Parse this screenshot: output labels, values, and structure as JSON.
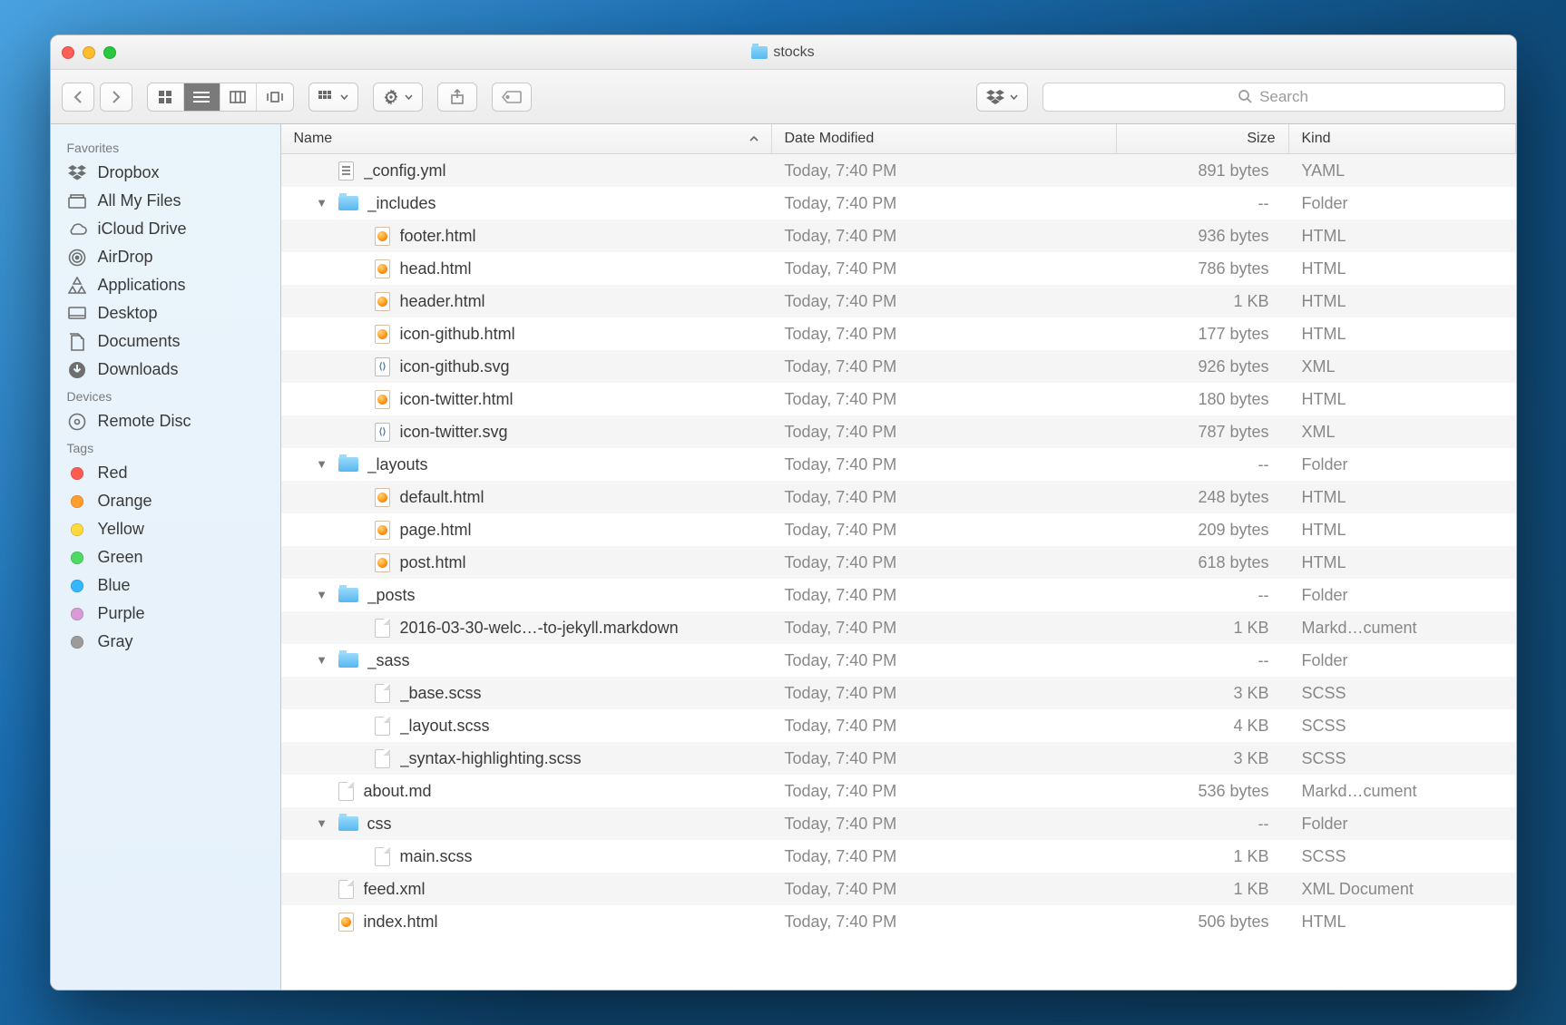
{
  "window": {
    "title": "stocks"
  },
  "toolbar": {
    "search_placeholder": "Search"
  },
  "sidebar": {
    "sections": [
      {
        "heading": "Favorites",
        "items": [
          {
            "icon": "dropbox-icon",
            "label": "Dropbox"
          },
          {
            "icon": "all-files-icon",
            "label": "All My Files"
          },
          {
            "icon": "cloud-icon",
            "label": "iCloud Drive"
          },
          {
            "icon": "airdrop-icon",
            "label": "AirDrop"
          },
          {
            "icon": "apps-icon",
            "label": "Applications"
          },
          {
            "icon": "desktop-icon",
            "label": "Desktop"
          },
          {
            "icon": "documents-icon",
            "label": "Documents"
          },
          {
            "icon": "downloads-icon",
            "label": "Downloads"
          }
        ]
      },
      {
        "heading": "Devices",
        "items": [
          {
            "icon": "disc-icon",
            "label": "Remote Disc"
          }
        ]
      },
      {
        "heading": "Tags",
        "items": [
          {
            "icon": "tag-dot",
            "color": "#ff5b52",
            "label": "Red"
          },
          {
            "icon": "tag-dot",
            "color": "#ff9e2d",
            "label": "Orange"
          },
          {
            "icon": "tag-dot",
            "color": "#ffd93b",
            "label": "Yellow"
          },
          {
            "icon": "tag-dot",
            "color": "#4cd964",
            "label": "Green"
          },
          {
            "icon": "tag-dot",
            "color": "#35b7ff",
            "label": "Blue"
          },
          {
            "icon": "tag-dot",
            "color": "#d99bd8",
            "label": "Purple"
          },
          {
            "icon": "tag-dot",
            "color": "#9b9b9b",
            "label": "Gray"
          }
        ]
      }
    ]
  },
  "columns": {
    "name": "Name",
    "date": "Date Modified",
    "size": "Size",
    "kind": "Kind"
  },
  "rows": [
    {
      "depth": 0,
      "disclosure": "",
      "type": "yaml",
      "name": "_config.yml",
      "date": "Today, 7:40 PM",
      "size": "891 bytes",
      "kind": "YAML"
    },
    {
      "depth": 0,
      "disclosure": "▼",
      "type": "folder",
      "name": "_includes",
      "date": "Today, 7:40 PM",
      "size": "--",
      "kind": "Folder"
    },
    {
      "depth": 1,
      "disclosure": "",
      "type": "html",
      "name": "footer.html",
      "date": "Today, 7:40 PM",
      "size": "936 bytes",
      "kind": "HTML"
    },
    {
      "depth": 1,
      "disclosure": "",
      "type": "html",
      "name": "head.html",
      "date": "Today, 7:40 PM",
      "size": "786 bytes",
      "kind": "HTML"
    },
    {
      "depth": 1,
      "disclosure": "",
      "type": "html",
      "name": "header.html",
      "date": "Today, 7:40 PM",
      "size": "1 KB",
      "kind": "HTML"
    },
    {
      "depth": 1,
      "disclosure": "",
      "type": "html",
      "name": "icon-github.html",
      "date": "Today, 7:40 PM",
      "size": "177 bytes",
      "kind": "HTML"
    },
    {
      "depth": 1,
      "disclosure": "",
      "type": "svg",
      "name": "icon-github.svg",
      "date": "Today, 7:40 PM",
      "size": "926 bytes",
      "kind": "XML"
    },
    {
      "depth": 1,
      "disclosure": "",
      "type": "html",
      "name": "icon-twitter.html",
      "date": "Today, 7:40 PM",
      "size": "180 bytes",
      "kind": "HTML"
    },
    {
      "depth": 1,
      "disclosure": "",
      "type": "svg",
      "name": "icon-twitter.svg",
      "date": "Today, 7:40 PM",
      "size": "787 bytes",
      "kind": "XML"
    },
    {
      "depth": 0,
      "disclosure": "▼",
      "type": "folder",
      "name": "_layouts",
      "date": "Today, 7:40 PM",
      "size": "--",
      "kind": "Folder"
    },
    {
      "depth": 1,
      "disclosure": "",
      "type": "html",
      "name": "default.html",
      "date": "Today, 7:40 PM",
      "size": "248 bytes",
      "kind": "HTML"
    },
    {
      "depth": 1,
      "disclosure": "",
      "type": "html",
      "name": "page.html",
      "date": "Today, 7:40 PM",
      "size": "209 bytes",
      "kind": "HTML"
    },
    {
      "depth": 1,
      "disclosure": "",
      "type": "html",
      "name": "post.html",
      "date": "Today, 7:40 PM",
      "size": "618 bytes",
      "kind": "HTML"
    },
    {
      "depth": 0,
      "disclosure": "▼",
      "type": "folder",
      "name": "_posts",
      "date": "Today, 7:40 PM",
      "size": "--",
      "kind": "Folder"
    },
    {
      "depth": 1,
      "disclosure": "",
      "type": "generic",
      "name": "2016-03-30-welc…-to-jekyll.markdown",
      "date": "Today, 7:40 PM",
      "size": "1 KB",
      "kind": "Markd…cument"
    },
    {
      "depth": 0,
      "disclosure": "▼",
      "type": "folder",
      "name": "_sass",
      "date": "Today, 7:40 PM",
      "size": "--",
      "kind": "Folder"
    },
    {
      "depth": 1,
      "disclosure": "",
      "type": "generic",
      "name": "_base.scss",
      "date": "Today, 7:40 PM",
      "size": "3 KB",
      "kind": "SCSS"
    },
    {
      "depth": 1,
      "disclosure": "",
      "type": "generic",
      "name": "_layout.scss",
      "date": "Today, 7:40 PM",
      "size": "4 KB",
      "kind": "SCSS"
    },
    {
      "depth": 1,
      "disclosure": "",
      "type": "generic",
      "name": "_syntax-highlighting.scss",
      "date": "Today, 7:40 PM",
      "size": "3 KB",
      "kind": "SCSS"
    },
    {
      "depth": 0,
      "disclosure": "",
      "type": "generic",
      "name": "about.md",
      "date": "Today, 7:40 PM",
      "size": "536 bytes",
      "kind": "Markd…cument"
    },
    {
      "depth": 0,
      "disclosure": "▼",
      "type": "folder",
      "name": "css",
      "date": "Today, 7:40 PM",
      "size": "--",
      "kind": "Folder"
    },
    {
      "depth": 1,
      "disclosure": "",
      "type": "generic",
      "name": "main.scss",
      "date": "Today, 7:40 PM",
      "size": "1 KB",
      "kind": "SCSS"
    },
    {
      "depth": 0,
      "disclosure": "",
      "type": "generic",
      "name": "feed.xml",
      "date": "Today, 7:40 PM",
      "size": "1 KB",
      "kind": "XML Document"
    },
    {
      "depth": 0,
      "disclosure": "",
      "type": "html",
      "name": "index.html",
      "date": "Today, 7:40 PM",
      "size": "506 bytes",
      "kind": "HTML"
    }
  ]
}
